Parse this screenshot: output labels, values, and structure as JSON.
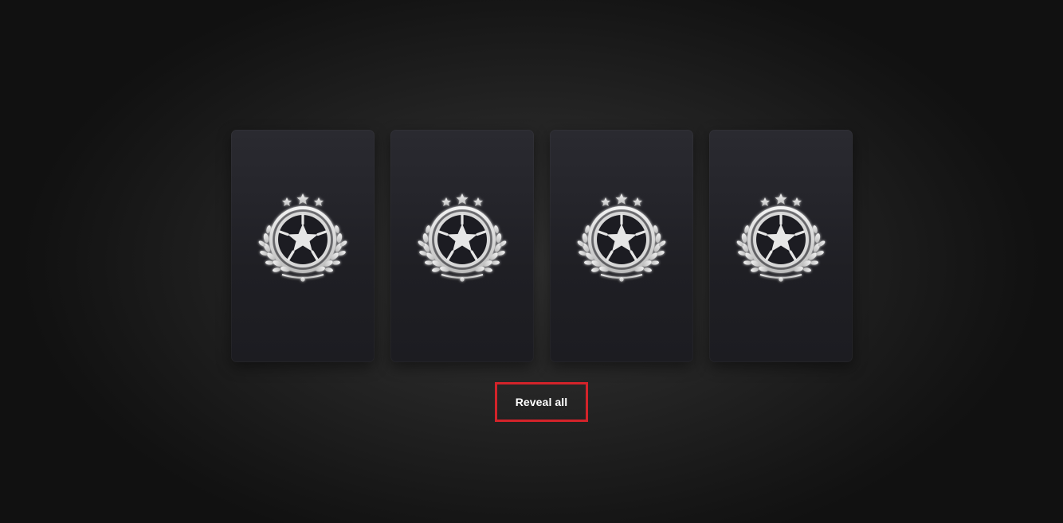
{
  "pack": {
    "cards": [
      {
        "state": "face-down",
        "icon": "football-crest-icon"
      },
      {
        "state": "face-down",
        "icon": "football-crest-icon"
      },
      {
        "state": "face-down",
        "icon": "football-crest-icon"
      },
      {
        "state": "face-down",
        "icon": "football-crest-icon"
      }
    ]
  },
  "actions": {
    "reveal_all_label": "Reveal all",
    "highlight_color": "#d3232a"
  }
}
